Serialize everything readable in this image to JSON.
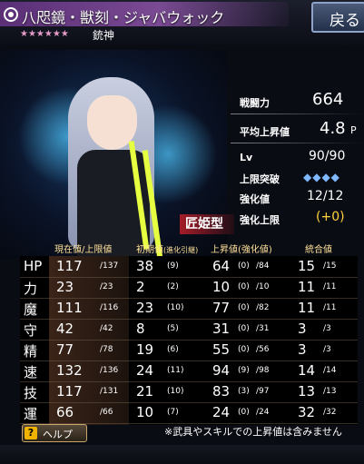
{
  "header": {
    "name": "八咫鏡・獣刻・ジャバウォック",
    "stars": "★★★★★★",
    "rank": "銃神",
    "back_label": "戻る"
  },
  "type_badge": "匠姫型",
  "info": {
    "power_label": "戦闘力",
    "power_value": "664",
    "avg_label": "平均上昇値",
    "avg_value": "4.8",
    "avg_unit": "P",
    "lv_label": "Lv",
    "lv_value": "90/90",
    "limit_break_label": "上限突破",
    "limit_break_diamonds": "◆◆◆◆",
    "enhance_label": "強化値",
    "enhance_value": "12/12",
    "enhance_limit_label": "強化上限",
    "enhance_limit_value": "(+0)"
  },
  "table": {
    "headers": {
      "current": "現在値/上限値",
      "initial": "初期値",
      "initial_note": "(進化引継)",
      "growth": "上昇値",
      "growth_note": "(強化値)",
      "integrated": "統合値"
    },
    "rows": [
      {
        "stat": "HP",
        "cur": "117",
        "cur_max": "/137",
        "init": "38",
        "init_sub": "(9)",
        "gr": "64",
        "gr_sub": "(0)",
        "gr_max": "/84",
        "int": "15",
        "int_max": "/15"
      },
      {
        "stat": "力",
        "cur": "23",
        "cur_max": "/23",
        "init": "2",
        "init_sub": "(2)",
        "gr": "10",
        "gr_sub": "(0)",
        "gr_max": "/10",
        "int": "11",
        "int_max": "/11"
      },
      {
        "stat": "魔",
        "cur": "111",
        "cur_max": "/116",
        "init": "23",
        "init_sub": "(10)",
        "gr": "77",
        "gr_sub": "(0)",
        "gr_max": "/82",
        "int": "11",
        "int_max": "/11"
      },
      {
        "stat": "守",
        "cur": "42",
        "cur_max": "/42",
        "init": "8",
        "init_sub": "(5)",
        "gr": "31",
        "gr_sub": "(0)",
        "gr_max": "/31",
        "int": "3",
        "int_max": "/3"
      },
      {
        "stat": "精",
        "cur": "77",
        "cur_max": "/78",
        "init": "19",
        "init_sub": "(6)",
        "gr": "55",
        "gr_sub": "(0)",
        "gr_max": "/56",
        "int": "3",
        "int_max": "/3"
      },
      {
        "stat": "速",
        "cur": "132",
        "cur_max": "/136",
        "init": "24",
        "init_sub": "(11)",
        "gr": "94",
        "gr_sub": "(9)",
        "gr_max": "/98",
        "int": "14",
        "int_max": "/14"
      },
      {
        "stat": "技",
        "cur": "117",
        "cur_max": "/131",
        "init": "21",
        "init_sub": "(10)",
        "gr": "83",
        "gr_sub": "(3)",
        "gr_max": "/97",
        "int": "13",
        "int_max": "/13"
      },
      {
        "stat": "運",
        "cur": "66",
        "cur_max": "/66",
        "init": "10",
        "init_sub": "(7)",
        "gr": "24",
        "gr_sub": "(0)",
        "gr_max": "/24",
        "int": "32",
        "int_max": "/32"
      }
    ]
  },
  "help": {
    "icon": "?",
    "label": "ヘルプ"
  },
  "footnote": "※武具やスキルでの上昇値は含みません",
  "colors": {
    "accent_gold": "#ffe19a",
    "enhance_limit": "#ffd23f",
    "limit_diamond": "#7fb8ff",
    "type_badge": "#b41e28"
  }
}
